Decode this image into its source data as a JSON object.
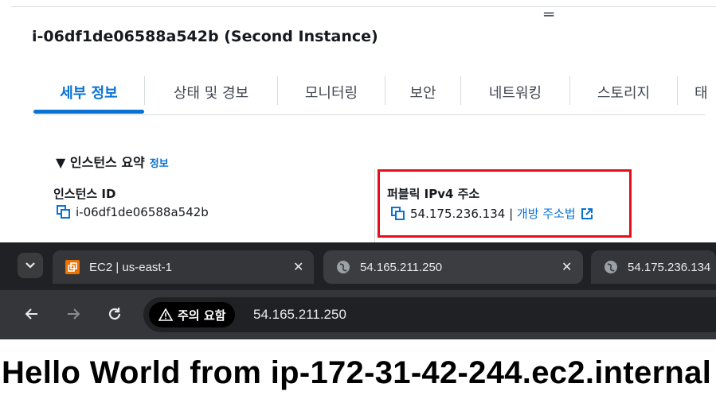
{
  "aws": {
    "instance_title": "i-06df1de06588a542b (Second Instance)",
    "tabs": [
      {
        "label": "세부 정보"
      },
      {
        "label": "상태 및 경보"
      },
      {
        "label": "모니터링"
      },
      {
        "label": "보안"
      },
      {
        "label": "네트워킹"
      },
      {
        "label": "스토리지"
      },
      {
        "label": "태"
      }
    ],
    "summary": {
      "heading": "▼ 인스턴스 요약",
      "info_link": "정보"
    },
    "instance_id": {
      "label": "인스턴스 ID",
      "value": "i-06df1de06588a542b"
    },
    "public_ipv4": {
      "label": "퍼블릭 IPv4 주소",
      "value": "54.175.236.134",
      "separator": " | ",
      "open_link": "개방 주소법"
    },
    "colors": {
      "accent": "#0972d3",
      "highlight": "#e3101b",
      "text": "#16191f"
    }
  },
  "browser": {
    "tabs": [
      {
        "title": "EC2 | us-east-1",
        "favicon": "aws-ec2-icon"
      },
      {
        "title": "54.165.211.250",
        "favicon": "globe-icon"
      },
      {
        "title": "54.175.236.134",
        "favicon": "globe-icon"
      }
    ],
    "security_chip": "주의 요함",
    "url": "54.165.211.250",
    "page_heading": "Hello World from ip-172-31-42-244.ec2.internal"
  }
}
